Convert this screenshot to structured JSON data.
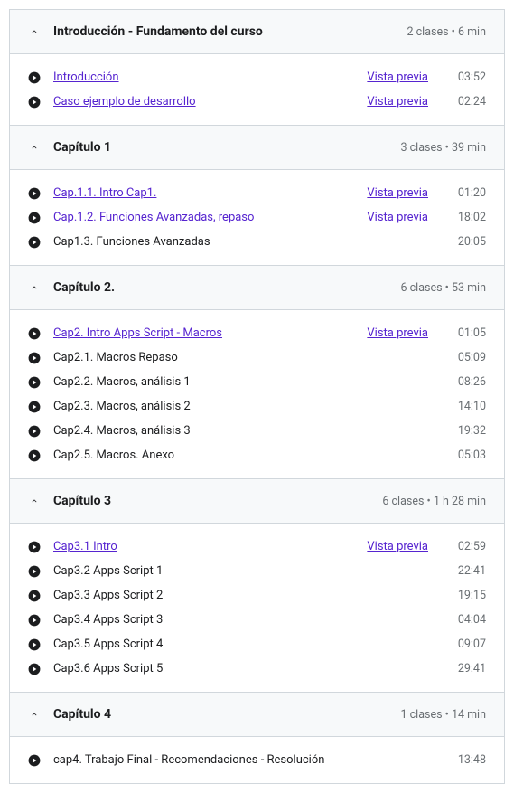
{
  "preview_label": "Vista previa",
  "sections": [
    {
      "title": "Introducción - Fundamento del curso",
      "meta": "2 clases • 6 min",
      "lectures": [
        {
          "title": "Introducción",
          "link": true,
          "preview": true,
          "duration": "03:52"
        },
        {
          "title": "Caso ejemplo de desarrollo",
          "link": true,
          "preview": true,
          "duration": "02:24"
        }
      ]
    },
    {
      "title": "Capítulo 1",
      "meta": "3 clases • 39 min",
      "lectures": [
        {
          "title": "Cap.1.1. Intro Cap1.",
          "link": true,
          "preview": true,
          "duration": "01:20"
        },
        {
          "title": "Cap.1.2. Funciones Avanzadas, repaso",
          "link": true,
          "preview": true,
          "duration": "18:02"
        },
        {
          "title": "Cap1.3. Funciones Avanzadas",
          "link": false,
          "preview": false,
          "duration": "20:05"
        }
      ]
    },
    {
      "title": "Capítulo 2.",
      "meta": "6 clases • 53 min",
      "lectures": [
        {
          "title": "Cap2. Intro Apps Script - Macros",
          "link": true,
          "preview": true,
          "duration": "01:05"
        },
        {
          "title": "Cap2.1. Macros Repaso",
          "link": false,
          "preview": false,
          "duration": "05:09"
        },
        {
          "title": "Cap2.2. Macros, análisis 1",
          "link": false,
          "preview": false,
          "duration": "08:26"
        },
        {
          "title": "Cap2.3. Macros, análisis 2",
          "link": false,
          "preview": false,
          "duration": "14:10"
        },
        {
          "title": "Cap2.4. Macros, análisis 3",
          "link": false,
          "preview": false,
          "duration": "19:32"
        },
        {
          "title": "Cap2.5. Macros. Anexo",
          "link": false,
          "preview": false,
          "duration": "05:03"
        }
      ]
    },
    {
      "title": "Capítulo 3",
      "meta": "6 clases • 1 h 28 min",
      "lectures": [
        {
          "title": "Cap3.1 Intro",
          "link": true,
          "preview": true,
          "duration": "02:59"
        },
        {
          "title": "Cap3.2 Apps Script 1",
          "link": false,
          "preview": false,
          "duration": "22:41"
        },
        {
          "title": "Cap3.3 Apps Script 2",
          "link": false,
          "preview": false,
          "duration": "19:15"
        },
        {
          "title": "Cap3.4 Apps Script 3",
          "link": false,
          "preview": false,
          "duration": "04:04"
        },
        {
          "title": "Cap3.5 Apps Script 4",
          "link": false,
          "preview": false,
          "duration": "09:07"
        },
        {
          "title": "Cap3.6 Apps Script 5",
          "link": false,
          "preview": false,
          "duration": "29:41"
        }
      ]
    },
    {
      "title": "Capítulo 4",
      "meta": "1 clases • 14 min",
      "lectures": [
        {
          "title": "cap4. Trabajo Final - Recomendaciones - Resolución",
          "link": false,
          "preview": false,
          "duration": "13:48"
        }
      ]
    }
  ]
}
